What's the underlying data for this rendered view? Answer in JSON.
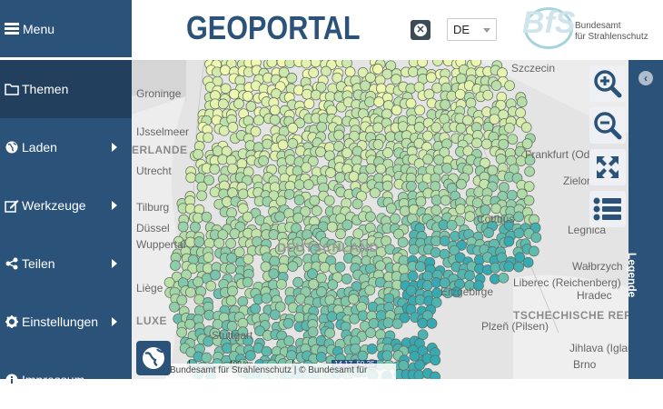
{
  "sidebar": {
    "menu_label": "Menu",
    "items": [
      {
        "label": "Themen",
        "icon": "folder-icon",
        "has_submenu": false,
        "active": true
      },
      {
        "label": "Laden",
        "icon": "globe-icon",
        "has_submenu": true,
        "active": false
      },
      {
        "label": "Werkzeuge",
        "icon": "edit-icon",
        "has_submenu": true,
        "active": false
      },
      {
        "label": "Teilen",
        "icon": "share-icon",
        "has_submenu": true,
        "active": false
      },
      {
        "label": "Einstellungen",
        "icon": "gear-icon",
        "has_submenu": true,
        "active": false
      },
      {
        "label": "Impressum",
        "icon": "info-icon",
        "has_submenu": false,
        "active": false
      }
    ]
  },
  "header": {
    "title": "GEOPORTAL",
    "language": "DE",
    "logo_mark": "BfS",
    "logo_line1": "Bundesamt",
    "logo_line2": "für Strahlenschutz"
  },
  "map": {
    "labels": [
      {
        "text": "Szczecin"
      },
      {
        "text": "Groninge"
      },
      {
        "text": "IJsselmeer"
      },
      {
        "text": "ERLANDE"
      },
      {
        "text": "Utrecht"
      },
      {
        "text": "Tilburg"
      },
      {
        "text": "Düssel"
      },
      {
        "text": "Wuppertal"
      },
      {
        "text": "Liège"
      },
      {
        "text": "LUXE"
      },
      {
        "text": "Frankfurt (Oder)"
      },
      {
        "text": "Zielona"
      },
      {
        "text": "Legnica"
      },
      {
        "text": "Wałbrzych"
      },
      {
        "text": "Liberec (Reichenberg)"
      },
      {
        "text": "TSCHECHISCHE REPUBLIK"
      },
      {
        "text": "Plzeň (Pilsen)"
      },
      {
        "text": "Jihlava (Iglau)"
      },
      {
        "text": "Brno"
      },
      {
        "text": "Cottbus"
      },
      {
        "text": "Hradec"
      },
      {
        "text": "DEUTSCHLAND"
      },
      {
        "text": "Erzgebirge"
      },
      {
        "text": "Stuttgart"
      }
    ],
    "scale_label": "100 km",
    "coordinates": "14.17, 50.25",
    "attribution": "Bundesamt für Strahlenschutz | © Bundesamt für",
    "colors": {
      "low": "#f2f9b0",
      "mid": "#a8d7a8",
      "high": "#36a9b3",
      "outline": "#5f6b5c"
    }
  },
  "controls": {
    "zoom_in": "zoom-in-icon",
    "zoom_out": "zoom-out-icon",
    "fullscreen": "fullscreen-icon",
    "layers": "list-icon"
  },
  "legend_panel": {
    "label": "Legende"
  }
}
